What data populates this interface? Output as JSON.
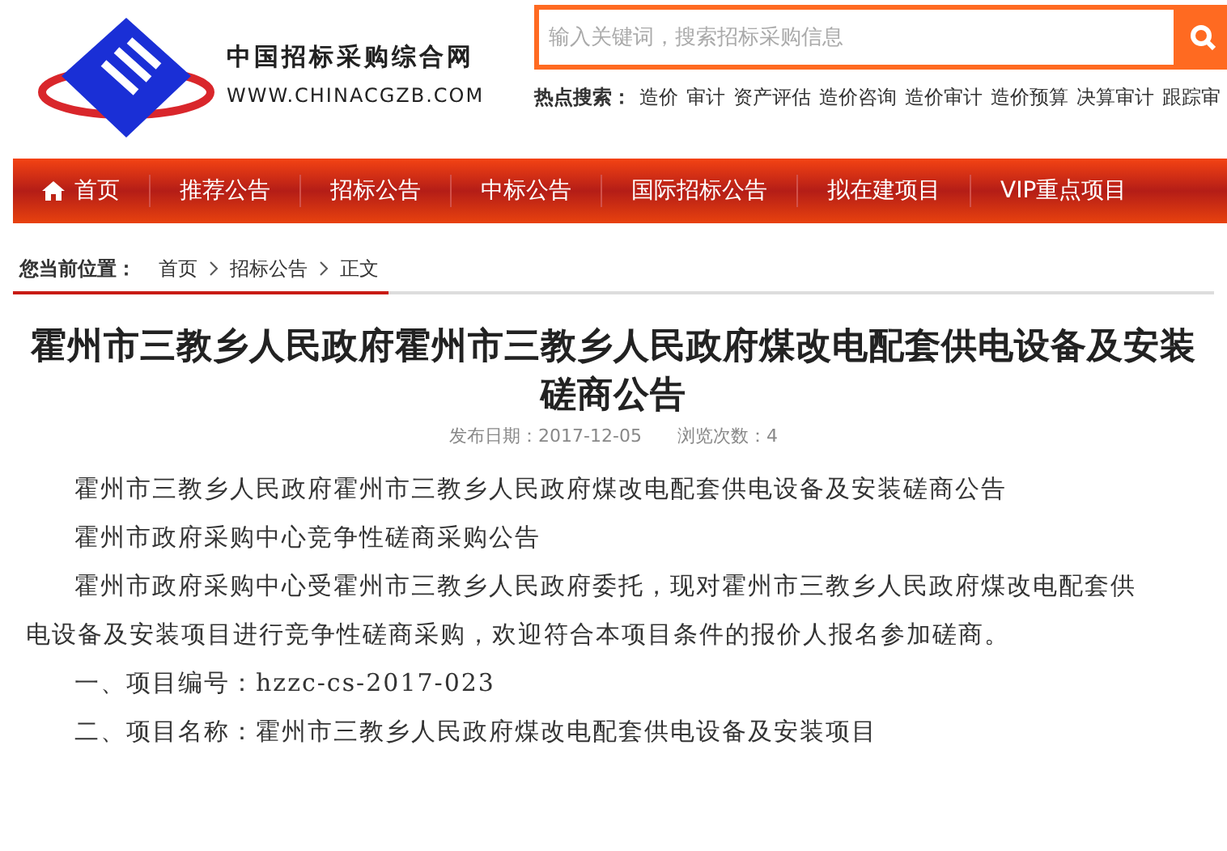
{
  "logo": {
    "name": "中国招标采购综合网",
    "url": "WWW.CHINACGZB.COM"
  },
  "search": {
    "placeholder": "输入关键词，搜索招标采购信息"
  },
  "hot_search": {
    "label": "热点搜索：",
    "terms": [
      "造价",
      "审计",
      "资产评估",
      "造价咨询",
      "造价审计",
      "造价预算",
      "决算审计",
      "跟踪审"
    ]
  },
  "nav": [
    {
      "label": "首页",
      "kind": "home"
    },
    {
      "label": "推荐公告",
      "kind": "link"
    },
    {
      "label": "招标公告",
      "kind": "link"
    },
    {
      "label": "中标公告",
      "kind": "link"
    },
    {
      "label": "国际招标公告",
      "kind": "link"
    },
    {
      "label": "拟在建项目",
      "kind": "link"
    },
    {
      "label": "VIP重点项目",
      "kind": "link"
    }
  ],
  "breadcrumb": {
    "label": "您当前位置：",
    "items": [
      "首页",
      "招标公告",
      "正文"
    ]
  },
  "article": {
    "title": "霍州市三教乡人民政府霍州市三教乡人民政府煤改电配套供电设备及安装磋商公告",
    "date": "发布日期：2017-12-05",
    "views": "浏览次数：4",
    "paragraphs": [
      "霍州市三教乡人民政府霍州市三教乡人民政府煤改电配套供电设备及安装磋商公告",
      "霍州市政府采购中心竞争性磋商采购公告",
      "霍州市政府采购中心受霍州市三教乡人民政府委托，现对霍州市三教乡人民政府煤改电配套供电设备及安装项目进行竞争性磋商采购，欢迎符合本项目条件的报价人报名参加磋商。",
      "一、项目编号：hzzc-cs-2017-023",
      "二、项目名称：霍州市三教乡人民政府煤改电配套供电设备及安装项目"
    ]
  }
}
